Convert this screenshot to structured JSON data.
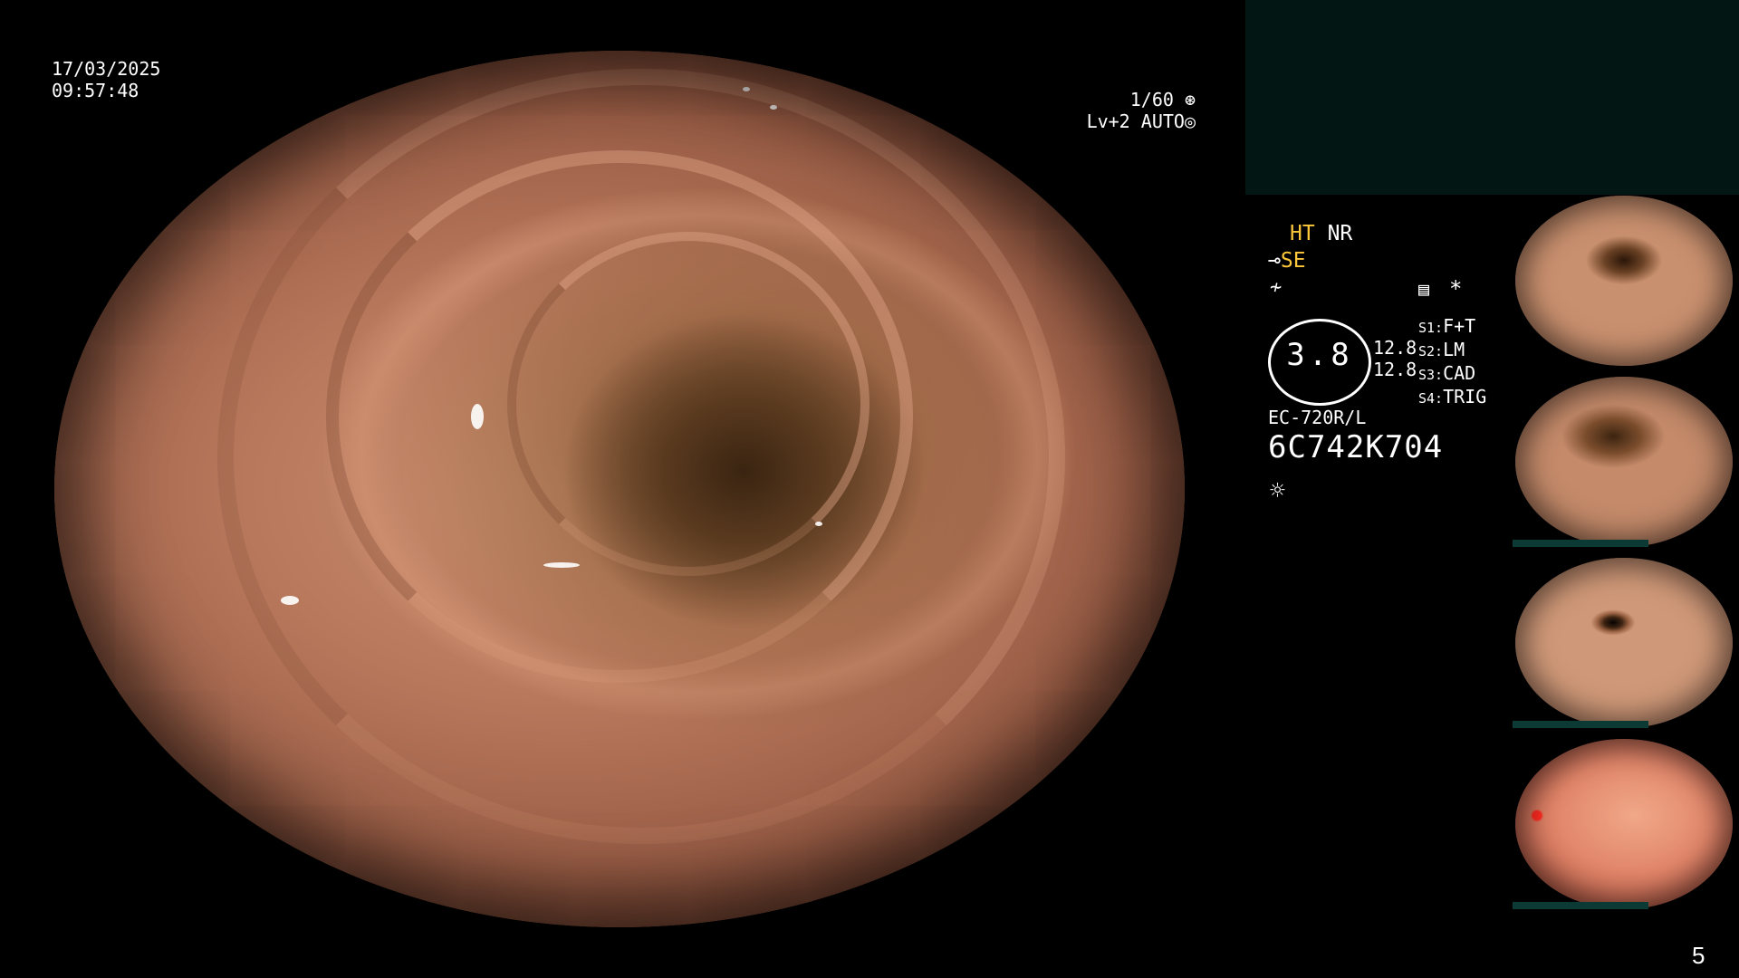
{
  "overlay": {
    "date": "17/03/2025",
    "time": "09:57:48",
    "shutter": "1/60",
    "level": "Lv+2",
    "mode": "AUTO"
  },
  "settings": {
    "ht": "HT",
    "nr": "NR",
    "se": "SE",
    "gauge_value": "3.8",
    "value_a": "12.8",
    "value_b": "12.8",
    "switches": [
      {
        "key": "S1:",
        "value": "F+T"
      },
      {
        "key": "S2:",
        "value": "LM"
      },
      {
        "key": "S3:",
        "value": "CAD"
      },
      {
        "key": "S4:",
        "value": "TRIG"
      }
    ],
    "asterisk": "*",
    "scope_model": "EC-720R/L",
    "scope_serial": "6C742K704"
  },
  "page_number": "5",
  "colors": {
    "accent_yellow": "#ffc83a",
    "panel_bg": "#021614"
  },
  "icons": [
    "shutter-icon",
    "auto-mode-icon",
    "scope-tip-icon",
    "wave-icon",
    "memo-icon",
    "brightness-icon"
  ]
}
